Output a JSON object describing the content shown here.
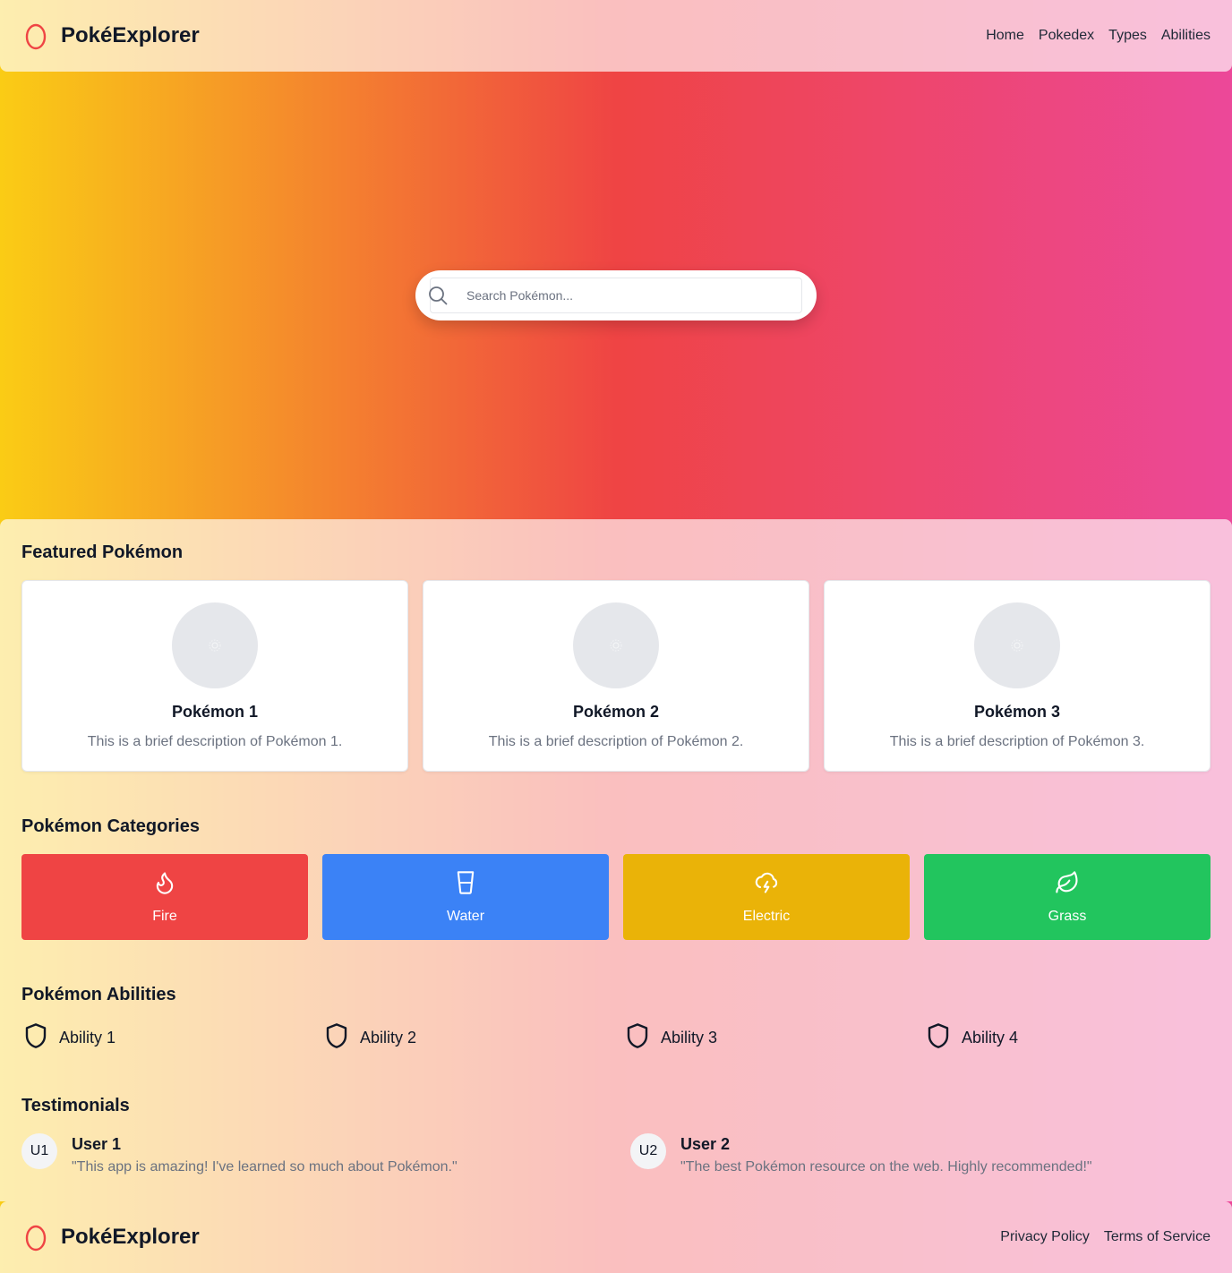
{
  "header": {
    "brand": "PokéExplorer",
    "nav": [
      {
        "label": "Home"
      },
      {
        "label": "Pokedex"
      },
      {
        "label": "Types"
      },
      {
        "label": "Abilities"
      }
    ]
  },
  "search": {
    "placeholder": "Search Pokémon...",
    "value": ""
  },
  "featured": {
    "title": "Featured Pokémon",
    "cards": [
      {
        "name": "Pokémon 1",
        "desc": "This is a brief description of Pokémon 1."
      },
      {
        "name": "Pokémon 2",
        "desc": "This is a brief description of Pokémon 2."
      },
      {
        "name": "Pokémon 3",
        "desc": "This is a brief description of Pokémon 3."
      }
    ]
  },
  "categories": {
    "title": "Pokémon Categories",
    "items": [
      {
        "label": "Fire",
        "icon": "flame-icon",
        "color": "#ef4444"
      },
      {
        "label": "Water",
        "icon": "cup-icon",
        "color": "#3b82f6"
      },
      {
        "label": "Electric",
        "icon": "cloud-lightning-icon",
        "color": "#eab308"
      },
      {
        "label": "Grass",
        "icon": "leaf-icon",
        "color": "#22c55e"
      }
    ]
  },
  "abilities": {
    "title": "Pokémon Abilities",
    "items": [
      {
        "label": "Ability 1",
        "icon": "shield-icon"
      },
      {
        "label": "Ability 2",
        "icon": "shield-icon"
      },
      {
        "label": "Ability 3",
        "icon": "shield-icon"
      },
      {
        "label": "Ability 4",
        "icon": "shield-icon"
      }
    ]
  },
  "testimonials": {
    "title": "Testimonials",
    "items": [
      {
        "initials": "U1",
        "user": "User 1",
        "quote": "\"This app is amazing! I've learned so much about Pokémon.\""
      },
      {
        "initials": "U2",
        "user": "User 2",
        "quote": "\"The best Pokémon resource on the web. Highly recommended!\""
      }
    ]
  },
  "footer": {
    "brand": "PokéExplorer",
    "links": [
      {
        "label": "Privacy Policy"
      },
      {
        "label": "Terms of Service"
      }
    ]
  },
  "colors": {
    "gradient_start": "#facc15",
    "gradient_mid": "#ef4444",
    "gradient_end": "#ec4899",
    "logo": "#ef4444"
  }
}
